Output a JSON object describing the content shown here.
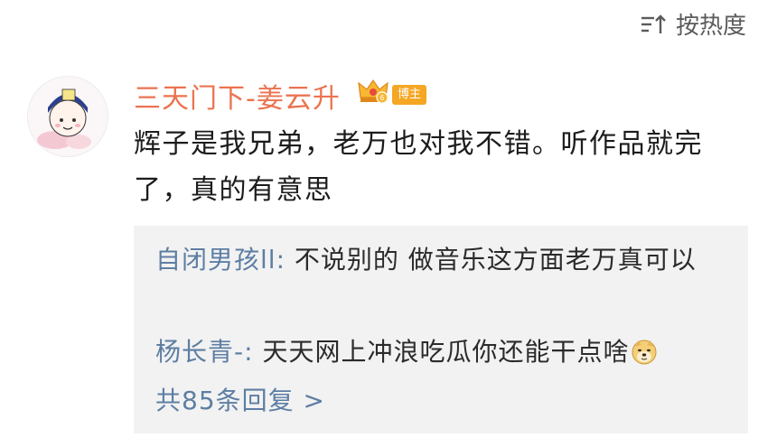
{
  "sort": {
    "label": "按热度",
    "icon": "sort-icon"
  },
  "comment": {
    "author": "三天门下-姜云升",
    "badge_text": "博主",
    "vip_icon": "crown-vip-icon",
    "text": "辉子是我兄弟，老万也对我不错。听作品就完了，真的有意思"
  },
  "replies": [
    {
      "user": "自闭男孩ll",
      "separator": ": ",
      "text": "不说别的 做音乐这方面老万真可以"
    },
    {
      "user": "杨长青-",
      "separator": ": ",
      "text": "天天网上冲浪吃瓜你还能干点啥",
      "emoji": "doge-emoji"
    }
  ],
  "more_replies": "共85条回复 >",
  "colors": {
    "username": "#eb7350",
    "reply_user": "#5d7ea3",
    "badge": "#f5a623",
    "reply_bg": "#f2f2f2"
  }
}
